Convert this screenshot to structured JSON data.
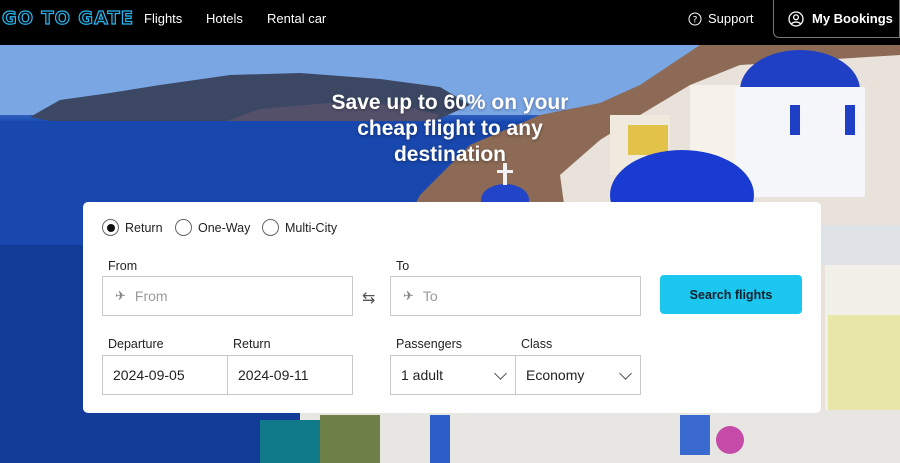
{
  "brand": {
    "logo_text": "GO TO GATE",
    "accent": "#27b7f2"
  },
  "nav": {
    "flights": "Flights",
    "hotels": "Hotels",
    "rental_car": "Rental car"
  },
  "header_right": {
    "support": "Support",
    "my_bookings": "My Bookings"
  },
  "hero": {
    "headline": "Save up to 60% on your cheap flight to any destination"
  },
  "search": {
    "trip_types": [
      {
        "label": "Return",
        "selected": true
      },
      {
        "label": "One-Way",
        "selected": false
      },
      {
        "label": "Multi-City",
        "selected": false
      }
    ],
    "from_label": "From",
    "from_placeholder": "From",
    "to_label": "To",
    "to_placeholder": "To",
    "search_button": "Search flights",
    "button_color": "#1cc7ef",
    "departure_label": "Departure",
    "departure_value": "2024-09-05",
    "return_label": "Return",
    "return_value": "2024-09-11",
    "passengers_label": "Passengers",
    "passengers_value": "1 adult",
    "class_label": "Class",
    "class_value": "Economy"
  }
}
